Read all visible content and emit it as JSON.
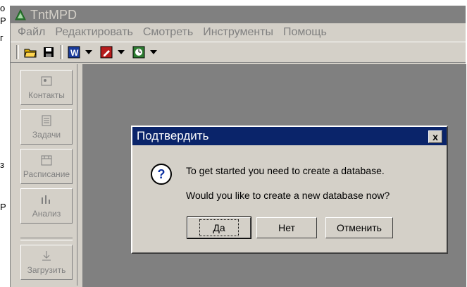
{
  "window": {
    "title": "TntMPD"
  },
  "menu": [
    "Файл",
    "Редактировать",
    "Смотреть",
    "Инструменты",
    "Помощь"
  ],
  "sidebar": [
    "Контакты",
    "Задачи",
    "Расписание",
    "Анализ",
    "Загрузить"
  ],
  "dialog": {
    "title": "Подтвердить",
    "line1": "To get started you need to create a database.",
    "line2": "Would you like to create a new database now?",
    "buttons": {
      "yes": "Да",
      "no": "Нет",
      "cancel": "Отменить"
    },
    "close_glyph": "x"
  },
  "cropped_left_text": [
    "о",
    "Р",
    "г",
    "з",
    "Р"
  ]
}
